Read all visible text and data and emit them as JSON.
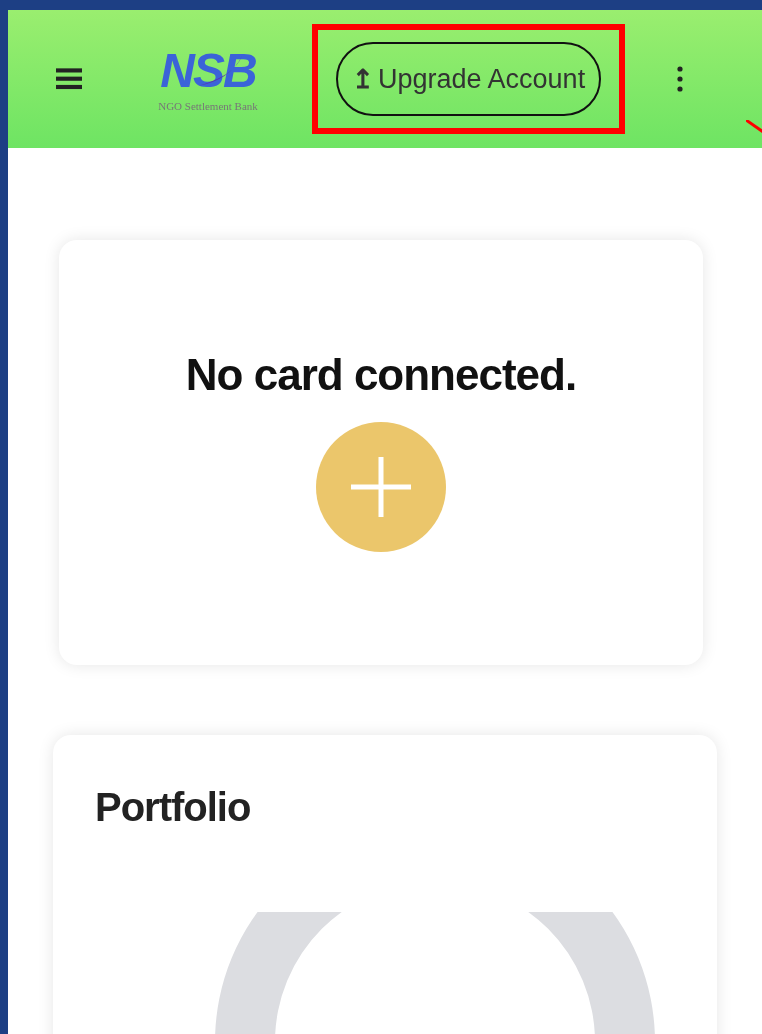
{
  "header": {
    "logo": {
      "mark": "NSB",
      "tagline": "NGO Settlement Bank"
    },
    "upgrade_button": {
      "icon": "↥",
      "label": "Upgrade Account",
      "highlighted": true
    }
  },
  "card_panel": {
    "message": "No card connected."
  },
  "portfolio": {
    "title": "Portfolio"
  }
}
